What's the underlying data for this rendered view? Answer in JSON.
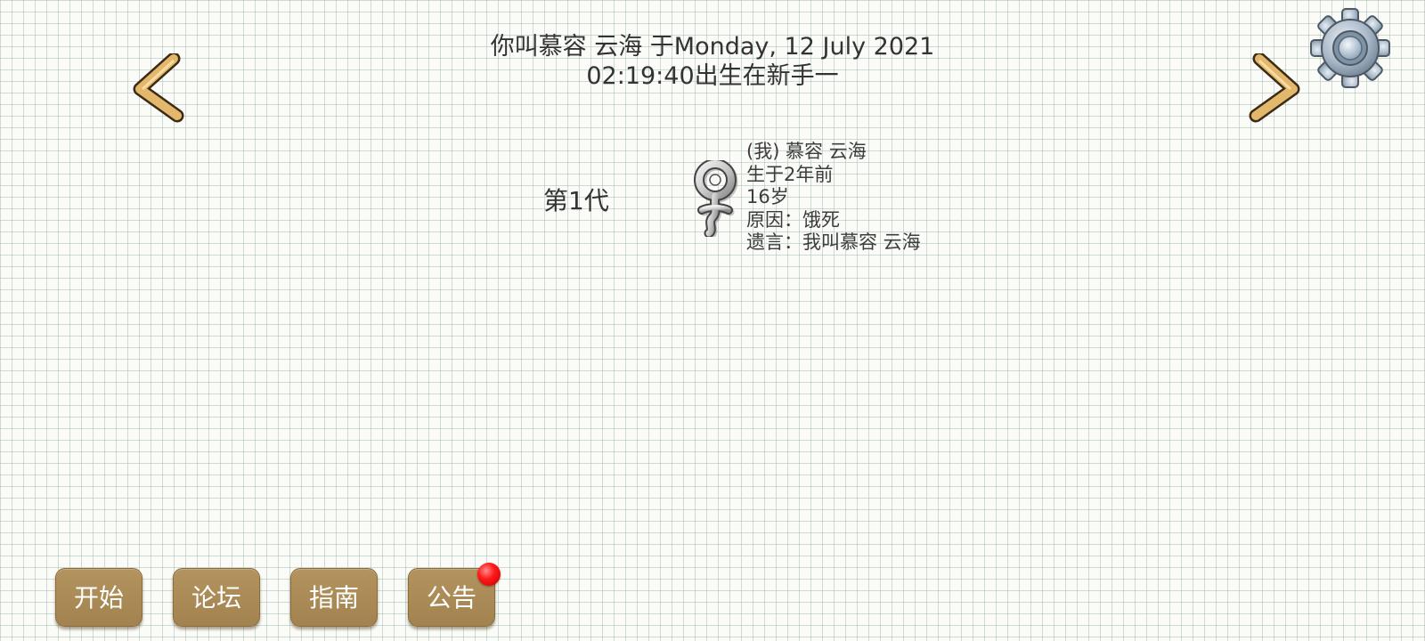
{
  "header": {
    "line1": "你叫慕容 云海 于Monday, 12 July 2021",
    "line2": "02:19:40出生在新手一"
  },
  "icons": {
    "prev": "chevron-left-icon",
    "next": "chevron-right-icon",
    "settings": "gear-icon",
    "person": "female-symbol-icon"
  },
  "generation": {
    "label": "第1代"
  },
  "person": {
    "name": "(我) 慕容 云海",
    "born": "生于2年前",
    "age": "16岁",
    "cause": "原因：饿死",
    "last_words": "遗言：我叫慕容 云海"
  },
  "menu": {
    "start": "开始",
    "forum": "论坛",
    "guide": "指南",
    "notice": "公告"
  },
  "colors": {
    "button": "#a98b57",
    "arrow": "#e0b56a",
    "notify": "#ff1a1a",
    "grid": "#b4c8c0"
  }
}
